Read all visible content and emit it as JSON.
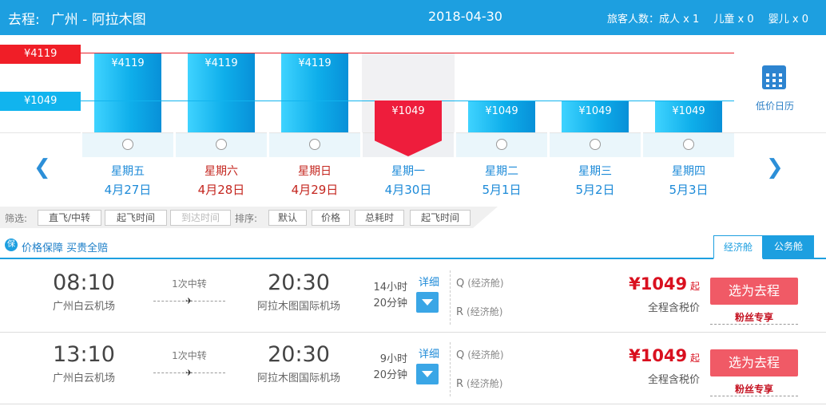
{
  "header": {
    "trip_label": "去程:",
    "route": "广州 - 阿拉木图",
    "date": "2018-04-30",
    "passengers": [
      "旅客人数：成人 x 1",
      "儿童 x 0",
      "婴儿 x 0"
    ]
  },
  "calendar": {
    "high_price": "¥4119",
    "low_price": "¥1049",
    "days": [
      {
        "weekday": "星期五",
        "date": "4月27日",
        "price": "¥4119",
        "level": "high",
        "weekend": false,
        "selected": false
      },
      {
        "weekday": "星期六",
        "date": "4月28日",
        "price": "¥4119",
        "level": "high",
        "weekend": true,
        "selected": false
      },
      {
        "weekday": "星期日",
        "date": "4月29日",
        "price": "¥4119",
        "level": "high",
        "weekend": true,
        "selected": false
      },
      {
        "weekday": "星期一",
        "date": "4月30日",
        "price": "¥1049",
        "level": "low",
        "weekend": false,
        "selected": true
      },
      {
        "weekday": "星期二",
        "date": "5月1日",
        "price": "¥1049",
        "level": "low",
        "weekend": false,
        "selected": false
      },
      {
        "weekday": "星期三",
        "date": "5月2日",
        "price": "¥1049",
        "level": "low",
        "weekend": false,
        "selected": false
      },
      {
        "weekday": "星期四",
        "date": "5月3日",
        "price": "¥1049",
        "level": "low",
        "weekend": false,
        "selected": false
      }
    ],
    "prev_icon": "chevron-left-icon",
    "next_icon": "chevron-right-icon",
    "low_price_calendar_label": "低价日历",
    "low_price_calendar_icon": "calendar-icon"
  },
  "filter": {
    "filter_label": "筛选:",
    "sort_label": "排序:",
    "filter_buttons": [
      "直飞/中转",
      "起飞时间",
      "到达时间"
    ],
    "sort_buttons": [
      "默认",
      "价格",
      "总耗时",
      "起飞时间"
    ]
  },
  "guarantee": {
    "icon_text": "保",
    "text": "价格保障 买贵全赔"
  },
  "cabin_tabs": [
    "经济舱",
    "公务舱"
  ],
  "flights": [
    {
      "dep_time": "08:10",
      "dep_airport": "广州白云机场",
      "transfer": "1次中转",
      "arr_time": "20:30",
      "arr_airport": "阿拉木图国际机场",
      "duration_h": "14小时",
      "duration_m": "20分钟",
      "detail_label": "详细",
      "cabins": [
        {
          "code": "Q",
          "name": "(经济舱)"
        },
        {
          "code": "R",
          "name": "(经济舱)"
        }
      ],
      "price": "¥1049",
      "price_suffix": "起",
      "tax_note": "全程含税价",
      "select_label": "选为去程",
      "fans_label": "粉丝专享"
    },
    {
      "dep_time": "13:10",
      "dep_airport": "广州白云机场",
      "transfer": "1次中转",
      "arr_time": "20:30",
      "arr_airport": "阿拉木图国际机场",
      "duration_h": "9小时",
      "duration_m": "20分钟",
      "detail_label": "详细",
      "cabins": [
        {
          "code": "Q",
          "name": "(经济舱)"
        },
        {
          "code": "R",
          "name": "(经济舱)"
        }
      ],
      "price": "¥1049",
      "price_suffix": "起",
      "tax_note": "全程含税价",
      "select_label": "选为去程",
      "fans_label": "粉丝专享"
    }
  ],
  "colors": {
    "brand": "#1d9fe0",
    "high_line": "#e8212b",
    "selected_bar": "#ee1d3c",
    "select_button": "#f05a66",
    "price_red": "#d9101f"
  }
}
